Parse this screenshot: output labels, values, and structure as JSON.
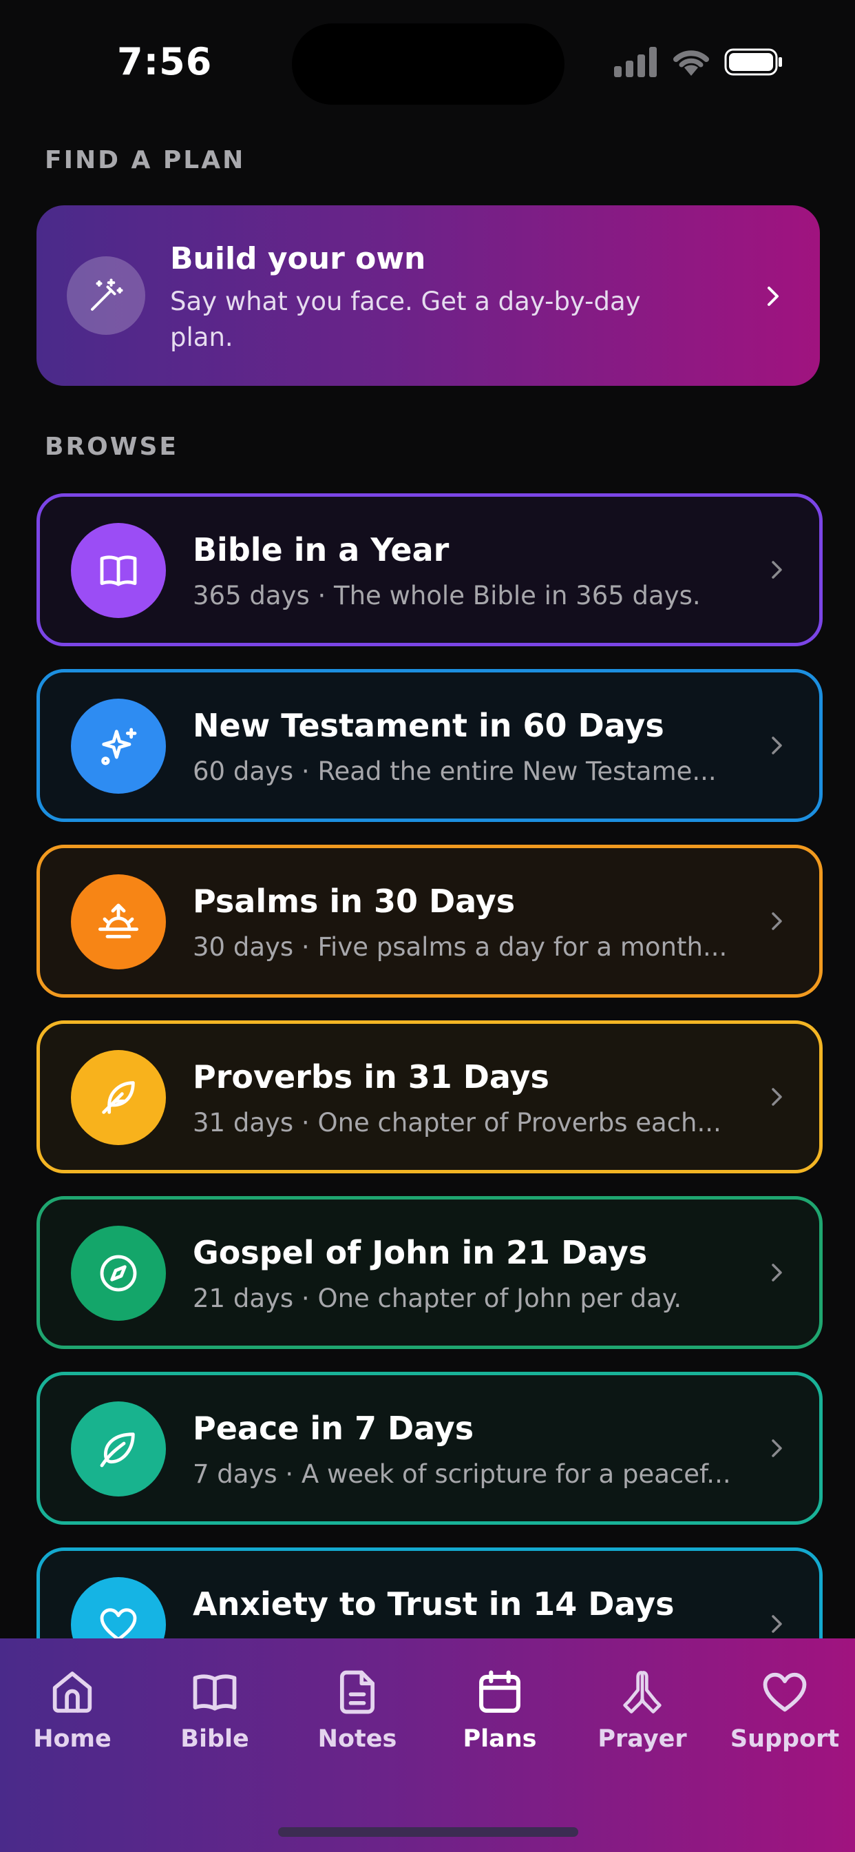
{
  "status_bar": {
    "time": "7:56"
  },
  "find_section": {
    "label": "FIND A PLAN"
  },
  "build_card": {
    "title": "Build your own",
    "subtitle": "Say what you face. Get a day-by-day plan.",
    "icon": "magic-wand-icon"
  },
  "browse_section": {
    "label": "BROWSE"
  },
  "plans": [
    {
      "title": "Bible in a Year",
      "subtitle": "365 days · The whole Bible in 365 days.",
      "icon": "book-icon",
      "border": "#7b45e6",
      "bg": "#120d1c",
      "icon_bg": "#9b4df5"
    },
    {
      "title": "New Testament in 60 Days",
      "subtitle": "60 days · Read the entire New Testame...",
      "icon": "sparkles-icon",
      "border": "#1c8fe0",
      "bg": "#0b131a",
      "icon_bg": "#2e8cf2"
    },
    {
      "title": "Psalms in 30 Days",
      "subtitle": "30 days · Five psalms a day for a month...",
      "icon": "sunrise-icon",
      "border": "#f29a1f",
      "bg": "#1a140d",
      "icon_bg": "#f78515"
    },
    {
      "title": "Proverbs in 31 Days",
      "subtitle": "31 days · One chapter of Proverbs each...",
      "icon": "feather-icon",
      "border": "#f3b524",
      "bg": "#19150d",
      "icon_bg": "#f8b21c"
    },
    {
      "title": "Gospel of John in 21 Days",
      "subtitle": "21 days · One chapter of John per day.",
      "icon": "compass-icon",
      "border": "#1fa670",
      "bg": "#0c1612",
      "icon_bg": "#14a66a"
    },
    {
      "title": "Peace in 7 Days",
      "subtitle": "7 days · A week of scripture for a peacef...",
      "icon": "leaf-icon",
      "border": "#19b298",
      "bg": "#0c1614",
      "icon_bg": "#18b38e"
    },
    {
      "title": "Anxiety to Trust in 14 Days",
      "subtitle": "",
      "icon": "heart-icon",
      "border": "#14a9cf",
      "bg": "#0b1519",
      "icon_bg": "#15b4e4"
    }
  ],
  "tabs": [
    {
      "label": "Home",
      "icon": "home-icon",
      "active": false
    },
    {
      "label": "Bible",
      "icon": "book-icon",
      "active": false
    },
    {
      "label": "Notes",
      "icon": "document-icon",
      "active": false
    },
    {
      "label": "Plans",
      "icon": "calendar-icon",
      "active": true
    },
    {
      "label": "Prayer",
      "icon": "praying-hands-icon",
      "active": false
    },
    {
      "label": "Support",
      "icon": "heart-icon",
      "active": false
    }
  ]
}
